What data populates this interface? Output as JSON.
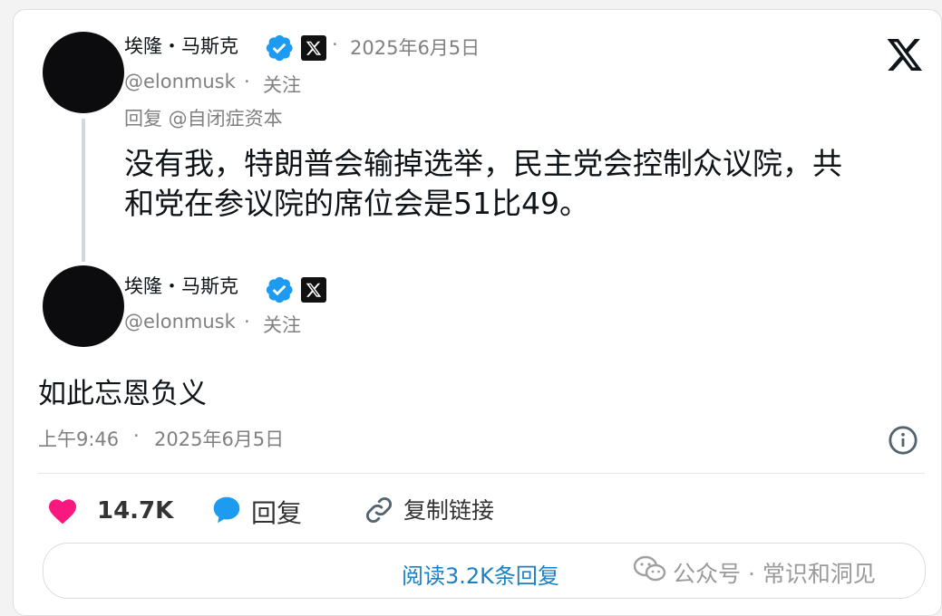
{
  "quoted_tweet": {
    "author_name": "埃隆・马斯克",
    "date": "2025年6月5日",
    "separator": "·",
    "handle": "@elonmusk",
    "follow": "关注",
    "reply_to": "回复 @自闭症资本",
    "text": "没有我，特朗普会输掉选举，民主党会控制众议院，共和党在参议院的席位会是51比49。"
  },
  "main_tweet": {
    "author_name": "埃隆・马斯克",
    "handle": "@elonmusk",
    "separator": "·",
    "follow": "关注",
    "text": "如此忘恩负义",
    "time": "上午9:46",
    "date": "2025年6月5日"
  },
  "actions": {
    "likes": "14.7K",
    "reply": "回复",
    "copy_link": "复制链接"
  },
  "read_replies": "阅读3.2K条回复",
  "watermark": "公众号 · 常识和洞见",
  "colors": {
    "like": "#f91880",
    "reply_icon": "#1d9bf0",
    "verified": "#1d9bf0",
    "link_text": "#1d7fc4"
  },
  "icons": [
    "x-logo-icon",
    "verified-icon",
    "x-badge-icon",
    "heart-icon",
    "reply-bubble-icon",
    "link-icon",
    "info-icon",
    "wechat-icon"
  ]
}
